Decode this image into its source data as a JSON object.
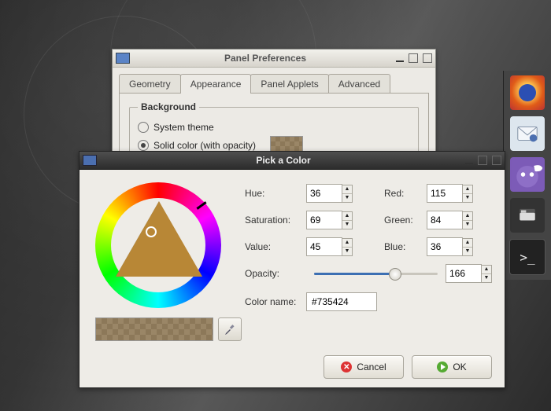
{
  "panel_prefs": {
    "title": "Panel Preferences",
    "tabs": [
      "Geometry",
      "Appearance",
      "Panel Applets",
      "Advanced"
    ],
    "active_tab": 1,
    "background": {
      "legend": "Background",
      "opt_system": "System theme",
      "opt_solid": "Solid color (with opacity)",
      "selected": "solid"
    }
  },
  "color_picker": {
    "title": "Pick a Color",
    "labels": {
      "hue": "Hue:",
      "saturation": "Saturation:",
      "value": "Value:",
      "red": "Red:",
      "green": "Green:",
      "blue": "Blue:",
      "opacity": "Opacity:",
      "color_name": "Color name:"
    },
    "values": {
      "hue": "36",
      "saturation": "69",
      "value": "45",
      "red": "115",
      "green": "84",
      "blue": "36",
      "opacity": "166",
      "color_name": "#735424"
    },
    "opacity_max": 255,
    "buttons": {
      "cancel": "Cancel",
      "ok": "OK"
    }
  },
  "dock": {
    "items": [
      "firefox",
      "mail",
      "pidgin",
      "file-manager",
      "terminal"
    ]
  }
}
